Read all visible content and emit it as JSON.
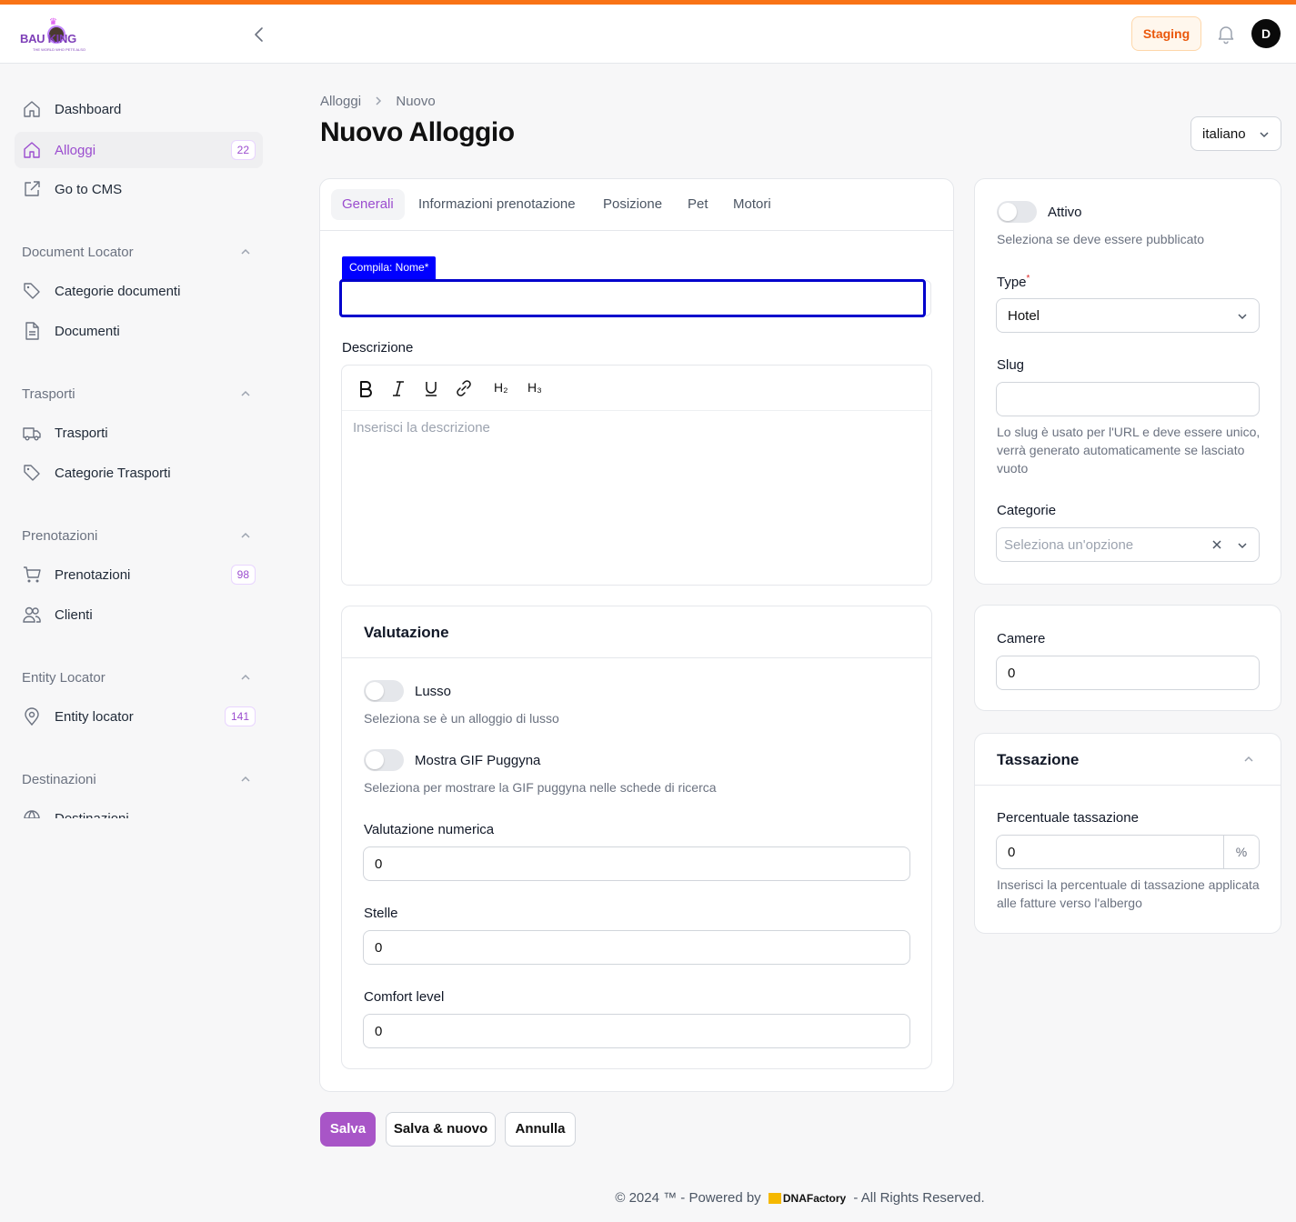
{
  "brand": {
    "logo_text": "BAU KING",
    "logo_sub": "THE WORLD WHO PETS ALSO"
  },
  "header": {
    "env_badge": "Staging",
    "avatar_initial": "D"
  },
  "sidebar": {
    "top_items": [
      {
        "label": "Dashboard",
        "icon": "home-icon"
      },
      {
        "label": "Alloggi",
        "icon": "home-icon",
        "badge": "22",
        "active": true
      },
      {
        "label": "Go to CMS",
        "icon": "external-link-icon"
      }
    ],
    "groups": [
      {
        "label": "Document Locator",
        "items": [
          {
            "label": "Categorie documenti"
          },
          {
            "label": "Documenti"
          }
        ]
      },
      {
        "label": "Trasporti",
        "items": [
          {
            "label": "Trasporti"
          },
          {
            "label": "Categorie Trasporti"
          }
        ]
      },
      {
        "label": "Prenotazioni",
        "items": [
          {
            "label": "Prenotazioni",
            "badge": "98"
          },
          {
            "label": "Clienti"
          }
        ]
      },
      {
        "label": "Entity Locator",
        "items": [
          {
            "label": "Entity locator",
            "badge": "141"
          }
        ]
      },
      {
        "label": "Destinazioni",
        "items": [
          {
            "label": "Destinazioni"
          }
        ]
      }
    ]
  },
  "breadcrumb": {
    "parent": "Alloggi",
    "current": "Nuovo"
  },
  "page": {
    "title": "Nuovo Alloggio",
    "language": "italiano"
  },
  "tabs": [
    "Generali",
    "Informazioni prenotazione",
    "Posizione",
    "Pet",
    "Motori"
  ],
  "form": {
    "name_hint": "Compila: Nome*",
    "description_label": "Descrizione",
    "description_placeholder": "Inserisci la descrizione",
    "toolbar": {
      "h2": "H₂",
      "h3": "H₃"
    }
  },
  "valutazione": {
    "title": "Valutazione",
    "lusso_label": "Lusso",
    "lusso_help": "Seleziona se è un alloggio di lusso",
    "gif_label": "Mostra GIF Puggyna",
    "gif_help": "Seleziona per mostrare la GIF puggyna nelle schede di ricerca",
    "numerica_label": "Valutazione numerica",
    "numerica_value": "0",
    "stelle_label": "Stelle",
    "stelle_value": "0",
    "comfort_label": "Comfort level",
    "comfort_value": "0"
  },
  "side": {
    "attivo_label": "Attivo",
    "attivo_help": "Seleziona se deve essere pubblicato",
    "type_label": "Type",
    "type_required": "*",
    "type_value": "Hotel",
    "slug_label": "Slug",
    "slug_help": "Lo slug è usato per l'URL e deve essere unico, verrà generato automaticamente se lasciato vuoto",
    "categorie_label": "Categorie",
    "categorie_placeholder": "Seleziona un'opzione",
    "camere_label": "Camere",
    "camere_value": "0",
    "tassazione_title": "Tassazione",
    "percentuale_label": "Percentuale tassazione",
    "percentuale_value": "0",
    "percentuale_suffix": "%",
    "percentuale_help": "Inserisci la percentuale di tassazione applicata alle fatture verso l'albergo"
  },
  "actions": {
    "save": "Salva",
    "save_new": "Salva & nuovo",
    "cancel": "Annulla"
  },
  "footer": {
    "prefix": "© 2024 ™ - Powered by",
    "brand": "DNAFactory",
    "suffix": "- All Rights Reserved."
  },
  "colors": {
    "accent": "#9b4dcf",
    "stripe": "#f97316",
    "focus": "#0000cc"
  }
}
